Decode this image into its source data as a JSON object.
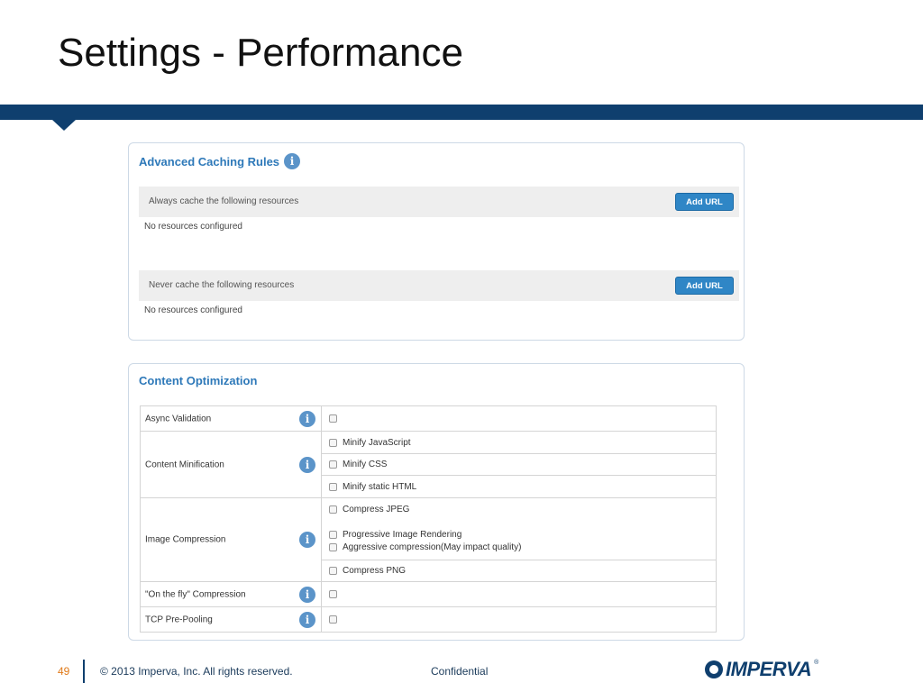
{
  "slide": {
    "title": "Settings - Performance"
  },
  "caching": {
    "title": "Advanced Caching Rules",
    "rules": [
      {
        "label": "Always cache the following resources",
        "button": "Add URL",
        "empty": "No resources configured"
      },
      {
        "label": "Never cache the following resources",
        "button": "Add URL",
        "empty": "No resources configured"
      }
    ]
  },
  "optimization": {
    "title": "Content Optimization",
    "rows": [
      {
        "label": "Async Validation",
        "options": []
      },
      {
        "label": "Content Minification",
        "options": [
          "Minify JavaScript",
          "Minify CSS",
          "Minify static HTML"
        ]
      },
      {
        "label": "Image Compression",
        "options": [
          "Compress JPEG",
          "Progressive Image Rendering",
          "Aggressive compression(May impact quality)",
          "Compress PNG"
        ]
      },
      {
        "label": "\"On the fly\" Compression",
        "options": []
      },
      {
        "label": "TCP Pre-Pooling",
        "options": []
      }
    ]
  },
  "footer": {
    "page_number": "49",
    "copyright": "© 2013 Imperva, Inc. All rights reserved.",
    "confidential": "Confidential",
    "logo_text": "IMPERVA",
    "logo_reg": "®"
  },
  "colors": {
    "brand_navy": "#0f3f6e",
    "accent_blue": "#2e79b9",
    "button_blue": "#2f86c6",
    "page_number_orange": "#e07a1a"
  },
  "icons": {
    "info": "info-icon",
    "checkbox": "checkbox"
  }
}
